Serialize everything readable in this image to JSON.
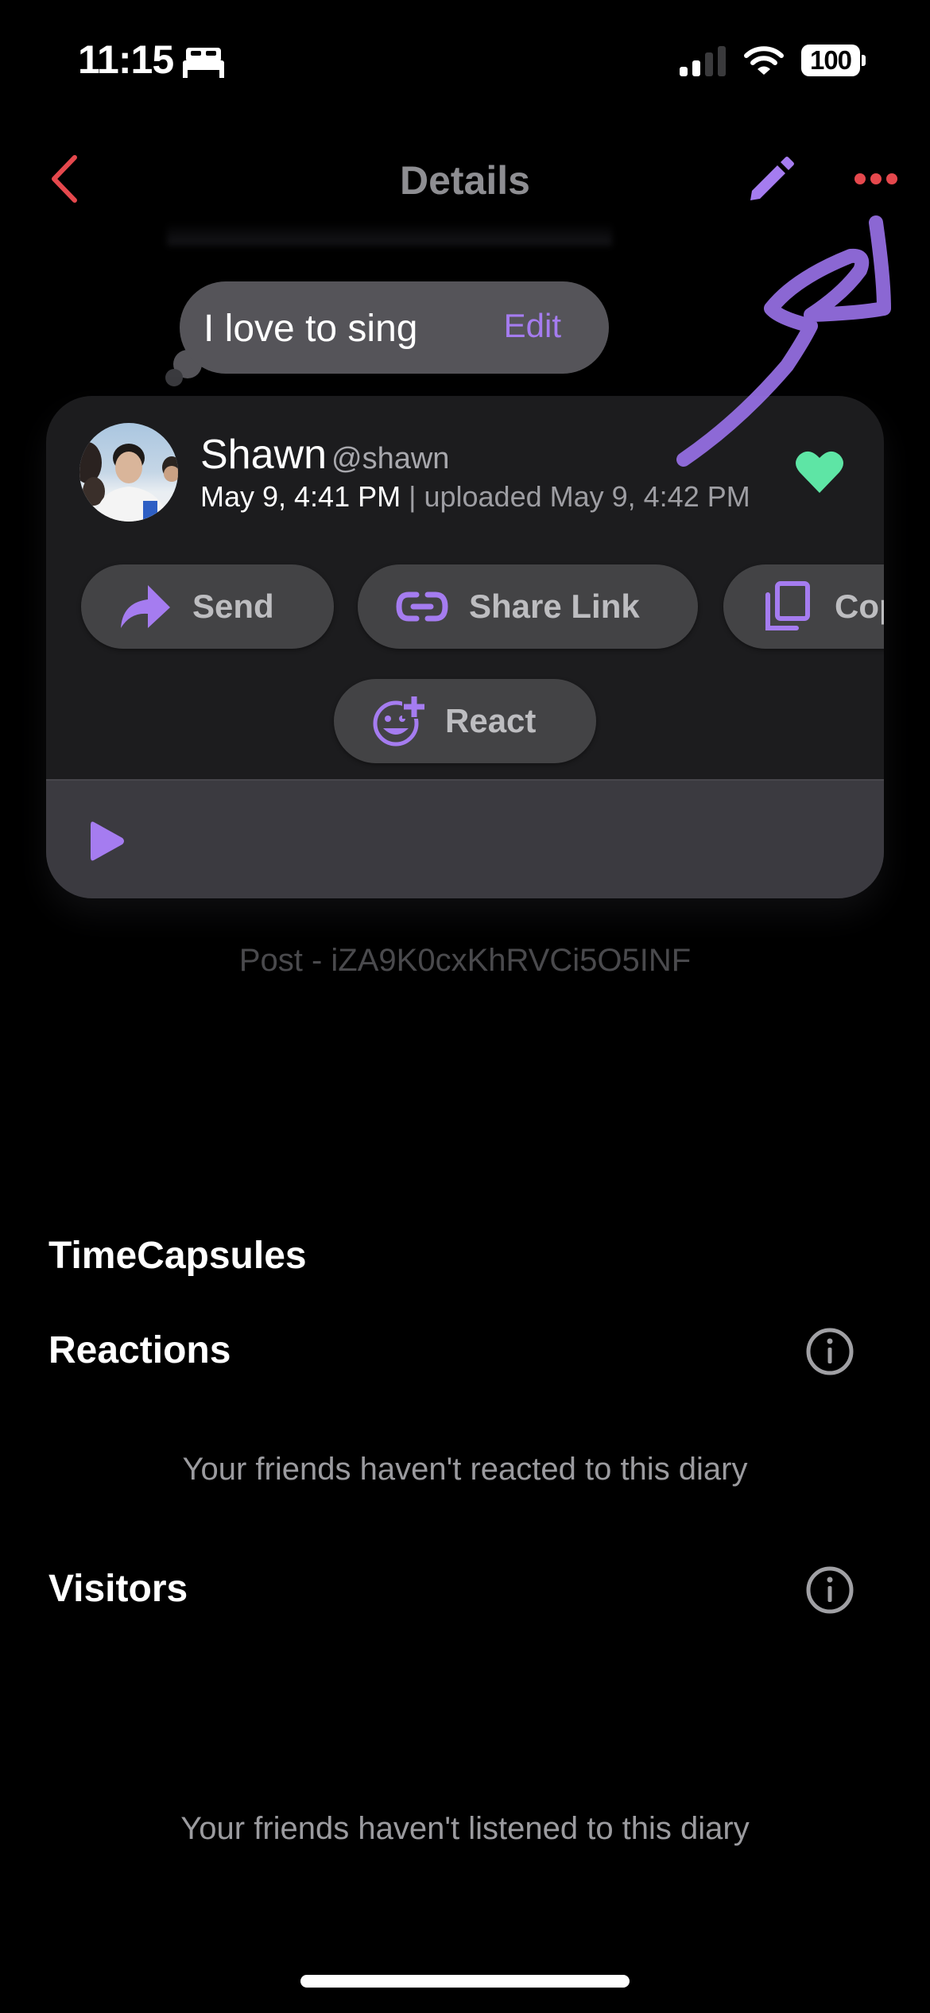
{
  "status_bar": {
    "time": "11:15",
    "focus_icon": "bed-icon",
    "signal_bars_filled": 2,
    "signal_bars_total": 4,
    "wifi_icon": "wifi-icon",
    "battery_percent": "100"
  },
  "nav": {
    "back_icon": "chevron-left-icon",
    "title": "Details",
    "edit_icon": "pencil-icon",
    "more_icon": "ellipsis-icon"
  },
  "caption": {
    "text": "I love to sing",
    "edit_label": "Edit"
  },
  "post": {
    "user_name": "Shawn",
    "user_handle": "@shawn",
    "recorded_at": "May 9, 4:41 PM",
    "separator": " | ",
    "uploaded_at": "uploaded May 9, 4:42 PM",
    "liked": true,
    "actions": [
      {
        "label": "Send",
        "icon": "share-arrow-icon"
      },
      {
        "label": "Share Link",
        "icon": "link-icon"
      },
      {
        "label": "Copy",
        "icon": "copy-icon"
      },
      {
        "label": "React",
        "icon": "add-reaction-icon"
      }
    ],
    "player_icon": "play-icon",
    "post_id_label": "Post - iZA9K0cxKhRVCi5O5INF"
  },
  "sections": {
    "timecapsules": {
      "title": "TimeCapsules"
    },
    "reactions": {
      "title": "Reactions",
      "empty_text": "Your friends haven't reacted to this diary"
    },
    "visitors": {
      "title": "Visitors",
      "empty_text": "Your friends haven't listened to this diary"
    }
  },
  "colors": {
    "accent_purple": "#a57cf0",
    "back_red": "#e5484d",
    "heart_green": "#5ee5a5",
    "card_bg": "#1c1c1e",
    "button_bg": "#434345"
  }
}
